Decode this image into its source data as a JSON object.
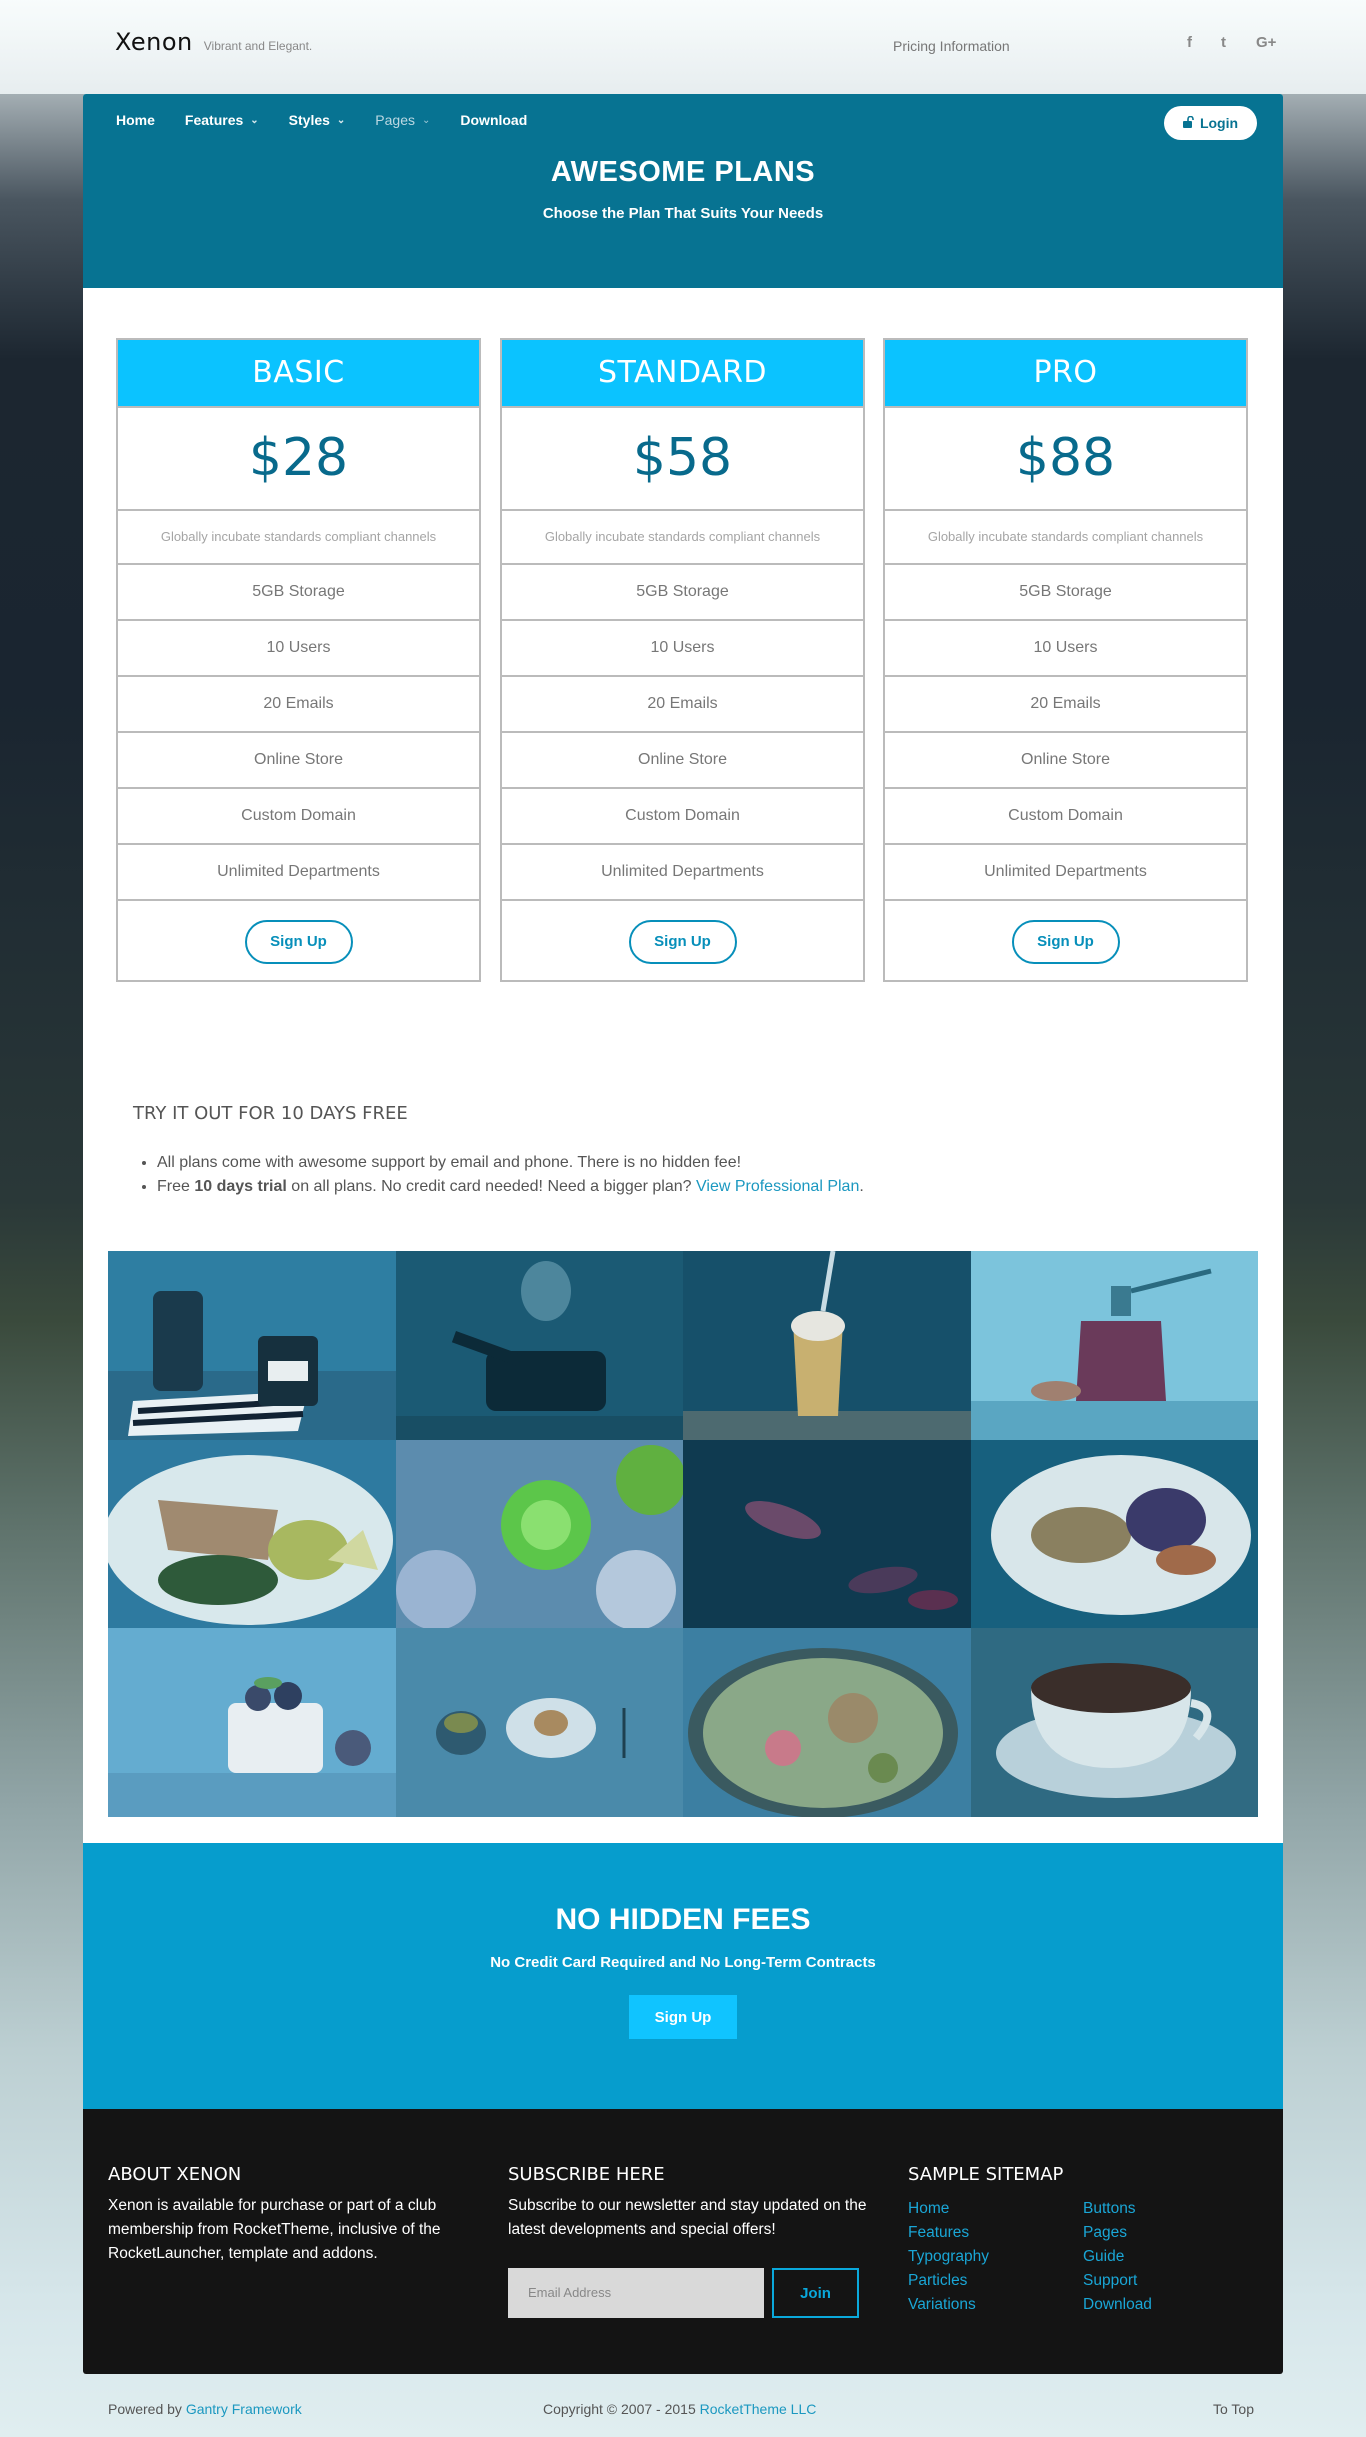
{
  "brand": {
    "name": "Xenon",
    "tagline": "Vibrant and Elegant."
  },
  "topbar": {
    "link": "Pricing Information",
    "social": [
      "f",
      "t",
      "G+"
    ],
    "social_names": [
      "facebook-icon",
      "twitter-icon",
      "google-plus-icon"
    ]
  },
  "nav": {
    "items": [
      {
        "label": "Home",
        "caret": false,
        "muted": false
      },
      {
        "label": "Features",
        "caret": true,
        "muted": false
      },
      {
        "label": "Styles",
        "caret": true,
        "muted": false
      },
      {
        "label": "Pages",
        "caret": true,
        "muted": true
      },
      {
        "label": "Download",
        "caret": false,
        "muted": false
      }
    ],
    "login_label": "Login"
  },
  "hero": {
    "title": "AWESOME PLANS",
    "subtitle": "Choose the Plan That Suits Your Needs"
  },
  "plans": [
    {
      "name": "BASIC",
      "price": "$28"
    },
    {
      "name": "STANDARD",
      "price": "$58"
    },
    {
      "name": "PRO",
      "price": "$88"
    }
  ],
  "plan_common": {
    "description": "Globally incubate standards compliant channels",
    "features": [
      "5GB Storage",
      "10 Users",
      "20 Emails",
      "Online Store",
      "Custom Domain",
      "Unlimited Departments"
    ],
    "signup_label": "Sign Up"
  },
  "trial": {
    "title": "TRY IT OUT FOR 10 DAYS FREE",
    "line1": "All plans come with awesome support by email and phone. There is no hidden fee!",
    "line2_a": "Free ",
    "line2_bold": "10 days trial",
    "line2_b": " on all plans. No credit card needed! Need a bigger plan? ",
    "line2_link": "View Professional Plan",
    "line2_end": "."
  },
  "cta": {
    "title": "NO HIDDEN FEES",
    "subtitle": "No Credit Card Required and No Long-Term Contracts",
    "button": "Sign Up"
  },
  "footer": {
    "about_title": "ABOUT XENON",
    "about_text": "Xenon is available for purchase or part of a club membership from RocketTheme, inclusive of the RocketLauncher, template and addons.",
    "subscribe_title": "SUBSCRIBE HERE",
    "subscribe_text": "Subscribe to our newsletter and stay updated on the latest developments and special offers!",
    "email_placeholder": "Email Address",
    "join_label": "Join",
    "sitemap_title": "SAMPLE SITEMAP",
    "sitemap_col1": [
      "Home",
      "Features",
      "Typography",
      "Particles",
      "Variations"
    ],
    "sitemap_col2": [
      "Buttons",
      "Pages",
      "Guide",
      "Support",
      "Download"
    ]
  },
  "bottom": {
    "powered_prefix": "Powered by ",
    "powered_link": "Gantry Framework",
    "copyright_prefix": "Copyright © 2007 - 2015 ",
    "copyright_link": "RocketTheme LLC",
    "to_top": "To Top"
  },
  "colors": {
    "hero": "#077392",
    "accent": "#0bc3ff",
    "cta": "#069dcd",
    "link": "#1b98c0"
  }
}
